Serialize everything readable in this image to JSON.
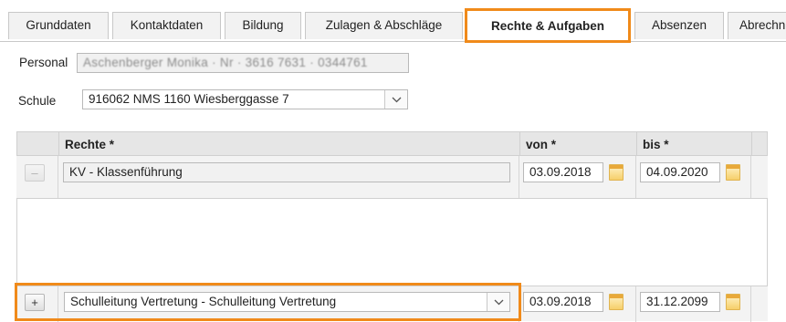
{
  "tabs": [
    {
      "label": "Grunddaten"
    },
    {
      "label": "Kontaktdaten"
    },
    {
      "label": "Bildung"
    },
    {
      "label": "Zulagen & Abschläge"
    },
    {
      "label": "Rechte & Aufgaben"
    },
    {
      "label": "Absenzen"
    },
    {
      "label": "Abrechn"
    }
  ],
  "personal": {
    "label": "Personal",
    "value": "Aschenberger Monika · Nr · 3616 7631 · 0344761"
  },
  "schule": {
    "label": "Schule",
    "value": "916062 NMS 1160 Wiesberggasse 7"
  },
  "table": {
    "col_rechte": "Rechte *",
    "col_von": "von *",
    "col_bis": "bis *",
    "rows": [
      {
        "button": "–",
        "recht": "KV - Klassenführung",
        "von": "03.09.2018",
        "bis": "04.09.2020"
      }
    ],
    "new_row": {
      "button": "+",
      "recht": "Schulleitung Vertretung - Schulleitung Vertretung",
      "von": "03.09.2018",
      "bis": "31.12.2099"
    }
  },
  "colors": {
    "accent": "#f08a1a"
  }
}
